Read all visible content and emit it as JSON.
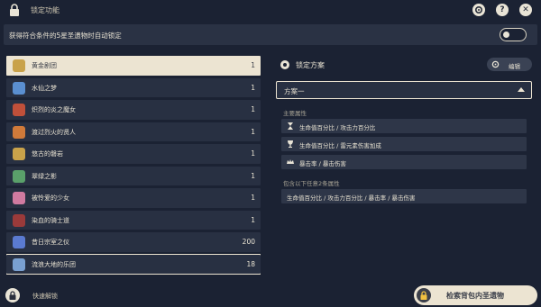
{
  "window": {
    "title": "锁定功能"
  },
  "top_icons": [
    {
      "name": "settings-icon"
    },
    {
      "name": "help-icon",
      "glyph": "?"
    },
    {
      "name": "close-icon",
      "glyph": "✕"
    }
  ],
  "auto_lock": {
    "label": "获得符合条件的5星圣遗物时自动锁定",
    "enabled": false
  },
  "artifact_sets": [
    {
      "name": "黄金剧团",
      "count": "1",
      "color": "#c9a24a",
      "selected": true
    },
    {
      "name": "水仙之梦",
      "count": "1",
      "color": "#5a8fd0"
    },
    {
      "name": "炽烈的炎之魔女",
      "count": "1",
      "color": "#c0503a"
    },
    {
      "name": "渡过烈火的贤人",
      "count": "1",
      "color": "#d07a3a"
    },
    {
      "name": "悠古的磐岩",
      "count": "1",
      "color": "#c9a24a"
    },
    {
      "name": "翠绿之影",
      "count": "1",
      "color": "#5aa06a"
    },
    {
      "name": "被怜爱的少女",
      "count": "1",
      "color": "#d07aa0"
    },
    {
      "name": "染血的骑士道",
      "count": "1",
      "color": "#9a3a3a"
    },
    {
      "name": "昔日宗室之仪",
      "count": "200",
      "color": "#5a7ad0"
    },
    {
      "name": "流浪大地的乐团",
      "count": "18",
      "color": "#7aa0d0",
      "outlined": true
    }
  ],
  "lock_plan": {
    "title": "锁定方案",
    "edit_label": "编辑",
    "selected_plan": "方案一",
    "main_stat_label": "主要属性",
    "main_stats": [
      {
        "text": "生命值百分比 / 攻击力百分比",
        "icon": "sands-icon"
      },
      {
        "text": "生命值百分比 / 雷元素伤害加成",
        "icon": "goblet-icon"
      },
      {
        "text": "暴击率 / 暴击伤害",
        "icon": "circlet-icon"
      }
    ],
    "sub_stat_label": "包含以下任意2条属性",
    "sub_stats": "生命值百分比 / 攻击力百分比 / 暴击率 / 暴击伤害"
  },
  "bottom": {
    "quick_unlock_label": "快速解锁",
    "search_label": "检索背包内圣遗物"
  }
}
